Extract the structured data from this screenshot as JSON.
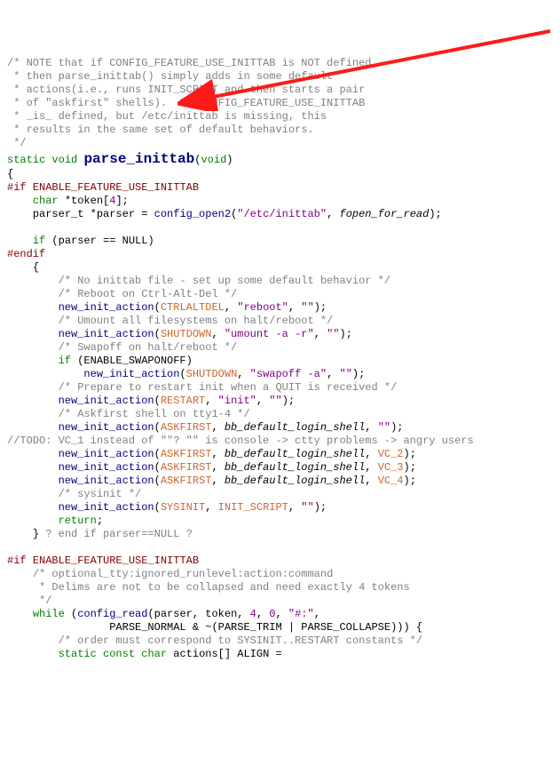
{
  "topComment": {
    "l1": "/* NOTE that if CONFIG_FEATURE_USE_INITTAB is NOT defined,",
    "l2": " * then parse_inittab() simply adds in some default",
    "l3": " * actions(i.e., runs INIT_SCRIPT and then starts a pair",
    "l4": " * of \"askfirst\" shells).  If CONFIG_FEATURE_USE_INITTAB",
    "l5": " * _is_ defined, but /etc/inittab is missing, this",
    "l6": " * results in the same set of default behaviors.",
    "l7": " */"
  },
  "decl": {
    "static": "static",
    "void": "void",
    "name": "parse_inittab",
    "params": "void"
  },
  "open": "{",
  "pp": {
    "if1": "#if",
    "if1cond": "ENABLE_FEATURE_USE_INITTAB",
    "endif": "#endif",
    "if2": "#if",
    "if2cond": "ENABLE_FEATURE_USE_INITTAB"
  },
  "body": {
    "char": "char",
    "token": "*token[",
    "four": "4",
    "tokenEnd": "];",
    "parsert": "parser_t",
    "parserDecl": " *parser = ",
    "configOpen": "config_open2",
    "etcinittab": "\"/etc/inittab\"",
    "fopen": "fopen_for_read",
    "if": "if",
    "parserNull": " (parser == NULL)"
  },
  "block": {
    "c1": "/* No inittab file - set up some default behavior */",
    "c2": "/* Reboot on Ctrl-Alt-Del */",
    "c3": "/* Umount all filesystems on halt/reboot */",
    "c4": "/* Swapoff on halt/reboot */",
    "c5": "/* Prepare to restart init when a QUIT is received */",
    "c6": "/* Askfirst shell on tty1-4 */",
    "c7": "//TODO: VC_1 instead of \"\"? \"\" is console -> ctty problems -> angry users",
    "c8": "/* sysinit */",
    "nia": "new_init_action",
    "ctrlaltdel": "CTRLALTDEL",
    "reboot": "\"reboot\"",
    "empty": "\"\"",
    "shutdown": "SHUTDOWN",
    "umount": "\"umount -a -r\"",
    "if": "if",
    "enableSwap": " (ENABLE_SWAPONOFF)",
    "swapoff": "\"swapoff -a\"",
    "restart": "RESTART",
    "init": "\"init\"",
    "askfirst": "ASKFIRST",
    "bbshell": "bb_default_login_shell",
    "vc2": "VC_2",
    "vc3": "VC_3",
    "vc4": "VC_4",
    "sysinit": "SYSINIT",
    "initscript": "INIT_SCRIPT",
    "return": "return",
    "endcomment": " ? end if parser==NULL ?"
  },
  "tail": {
    "c1": "/* optional_tty:ignored_runlevel:action:command",
    "c2": "     * Delims are not to be collapsed and need exactly 4 tokens",
    "c3": "     */",
    "while": "while",
    "configRead": "config_read",
    "hashcolon": "\"#:\"",
    "parseNormal": "PARSE_NORMAL & ~(PARSE_TRIM | PARSE_COLLAPSE))) {",
    "c4": "/* order must correspond to SYSINIT..RESTART constants */",
    "staticLine_static": "static",
    "staticLine_const": "const",
    "staticLine_char": "char",
    "staticLine_actions": "actions[] ALIGN ="
  }
}
